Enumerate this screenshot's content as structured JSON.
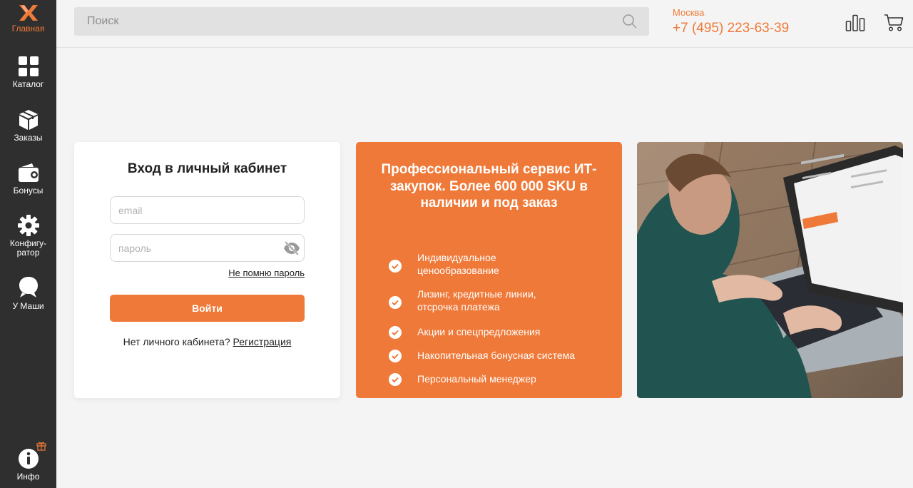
{
  "sidebar": {
    "items": [
      {
        "label": "Главная",
        "icon": "logo-x-icon",
        "active": true
      },
      {
        "label": "Каталог",
        "icon": "grid-icon"
      },
      {
        "label": "Заказы",
        "icon": "box-icon"
      },
      {
        "label": "Бонусы",
        "icon": "wallet-icon"
      },
      {
        "label": "Конфигу-\nратор",
        "icon": "gear-icon"
      },
      {
        "label": "У Маши",
        "icon": "chat-bubble-icon"
      },
      {
        "label": "Инфо",
        "icon": "info-icon"
      }
    ]
  },
  "header": {
    "search_placeholder": "Поиск",
    "city": "Москва",
    "phone": "+7 (495) 223-63-39"
  },
  "login": {
    "title": "Вход в личный кабинет",
    "email_placeholder": "email",
    "password_placeholder": "пароль",
    "forgot": "Не помню пароль",
    "submit": "Войти",
    "no_account": "Нет личного кабинета?",
    "register": "Регистрация"
  },
  "promo": {
    "title": "Профессиональный сервис ИТ-закупок. Более 600 000 SKU в наличии и под заказ",
    "benefits": [
      "Индивидуальное ценообразование",
      "Лизинг, кредитные линии, отсрочка платежа",
      "Акции и спецпредложения",
      "Накопительная бонусная система",
      "Персональный менеджер"
    ]
  },
  "colors": {
    "accent": "#ef7938",
    "sidebar": "#2f2f2f",
    "background": "#f4f4f4"
  }
}
